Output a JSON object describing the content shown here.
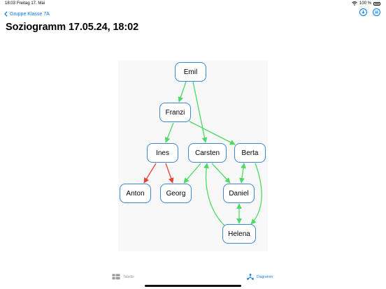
{
  "status": {
    "time": "18:03",
    "date": "Freitag 17. Mai",
    "battery": "100 %"
  },
  "nav": {
    "back_label": "Gruppe Klasse 7A"
  },
  "page": {
    "title": "Soziogramm 17.05.24, 18:02"
  },
  "diagram": {
    "nodes": {
      "emil": "Emil",
      "franzi": "Franzi",
      "ines": "Ines",
      "carsten": "Carsten",
      "berta": "Berta",
      "anton": "Anton",
      "georg": "Georg",
      "daniel": "Daniel",
      "helena": "Helena"
    },
    "colors": {
      "positive": "#4cd964",
      "negative": "#e8412f",
      "node_border": "#3a86d8"
    }
  },
  "tabs": {
    "table_label": "Tabelle",
    "diagram_label": "Diagramm"
  }
}
